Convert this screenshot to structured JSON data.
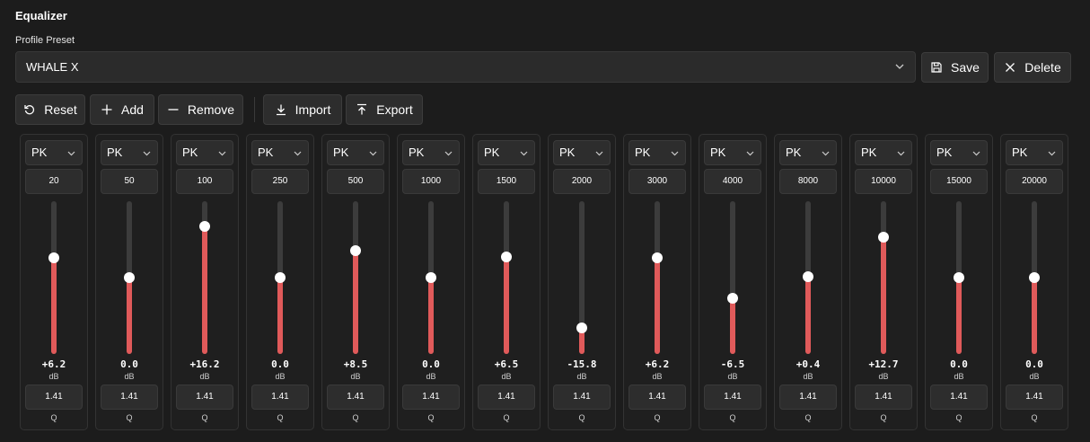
{
  "header": {
    "title": "Equalizer"
  },
  "preset": {
    "label": "Profile Preset",
    "selected": "WHALE X",
    "save_label": "Save",
    "delete_label": "Delete"
  },
  "toolbar": {
    "reset_label": "Reset",
    "add_label": "Add",
    "remove_label": "Remove",
    "import_label": "Import",
    "export_label": "Export"
  },
  "colors": {
    "accent": "#e05a5a",
    "background": "#1c1c1c",
    "control": "#2d2d2d"
  },
  "gain_range_db": [
    -24,
    24
  ],
  "bands": [
    {
      "type": "PK",
      "freq": "20",
      "gain": "+6.2",
      "gain_db": 6.2,
      "unit": "dB",
      "q": "1.41",
      "q_label": "Q"
    },
    {
      "type": "PK",
      "freq": "50",
      "gain": "0.0",
      "gain_db": 0.0,
      "unit": "dB",
      "q": "1.41",
      "q_label": "Q"
    },
    {
      "type": "PK",
      "freq": "100",
      "gain": "+16.2",
      "gain_db": 16.2,
      "unit": "dB",
      "q": "1.41",
      "q_label": "Q"
    },
    {
      "type": "PK",
      "freq": "250",
      "gain": "0.0",
      "gain_db": 0.0,
      "unit": "dB",
      "q": "1.41",
      "q_label": "Q"
    },
    {
      "type": "PK",
      "freq": "500",
      "gain": "+8.5",
      "gain_db": 8.5,
      "unit": "dB",
      "q": "1.41",
      "q_label": "Q"
    },
    {
      "type": "PK",
      "freq": "1000",
      "gain": "0.0",
      "gain_db": 0.0,
      "unit": "dB",
      "q": "1.41",
      "q_label": "Q"
    },
    {
      "type": "PK",
      "freq": "1500",
      "gain": "+6.5",
      "gain_db": 6.5,
      "unit": "dB",
      "q": "1.41",
      "q_label": "Q"
    },
    {
      "type": "PK",
      "freq": "2000",
      "gain": "-15.8",
      "gain_db": -15.8,
      "unit": "dB",
      "q": "1.41",
      "q_label": "Q"
    },
    {
      "type": "PK",
      "freq": "3000",
      "gain": "+6.2",
      "gain_db": 6.2,
      "unit": "dB",
      "q": "1.41",
      "q_label": "Q"
    },
    {
      "type": "PK",
      "freq": "4000",
      "gain": "-6.5",
      "gain_db": -6.5,
      "unit": "dB",
      "q": "1.41",
      "q_label": "Q"
    },
    {
      "type": "PK",
      "freq": "8000",
      "gain": "+0.4",
      "gain_db": 0.4,
      "unit": "dB",
      "q": "1.41",
      "q_label": "Q"
    },
    {
      "type": "PK",
      "freq": "10000",
      "gain": "+12.7",
      "gain_db": 12.7,
      "unit": "dB",
      "q": "1.41",
      "q_label": "Q"
    },
    {
      "type": "PK",
      "freq": "15000",
      "gain": "0.0",
      "gain_db": 0.0,
      "unit": "dB",
      "q": "1.41",
      "q_label": "Q"
    },
    {
      "type": "PK",
      "freq": "20000",
      "gain": "0.0",
      "gain_db": 0.0,
      "unit": "dB",
      "q": "1.41",
      "q_label": "Q"
    }
  ]
}
